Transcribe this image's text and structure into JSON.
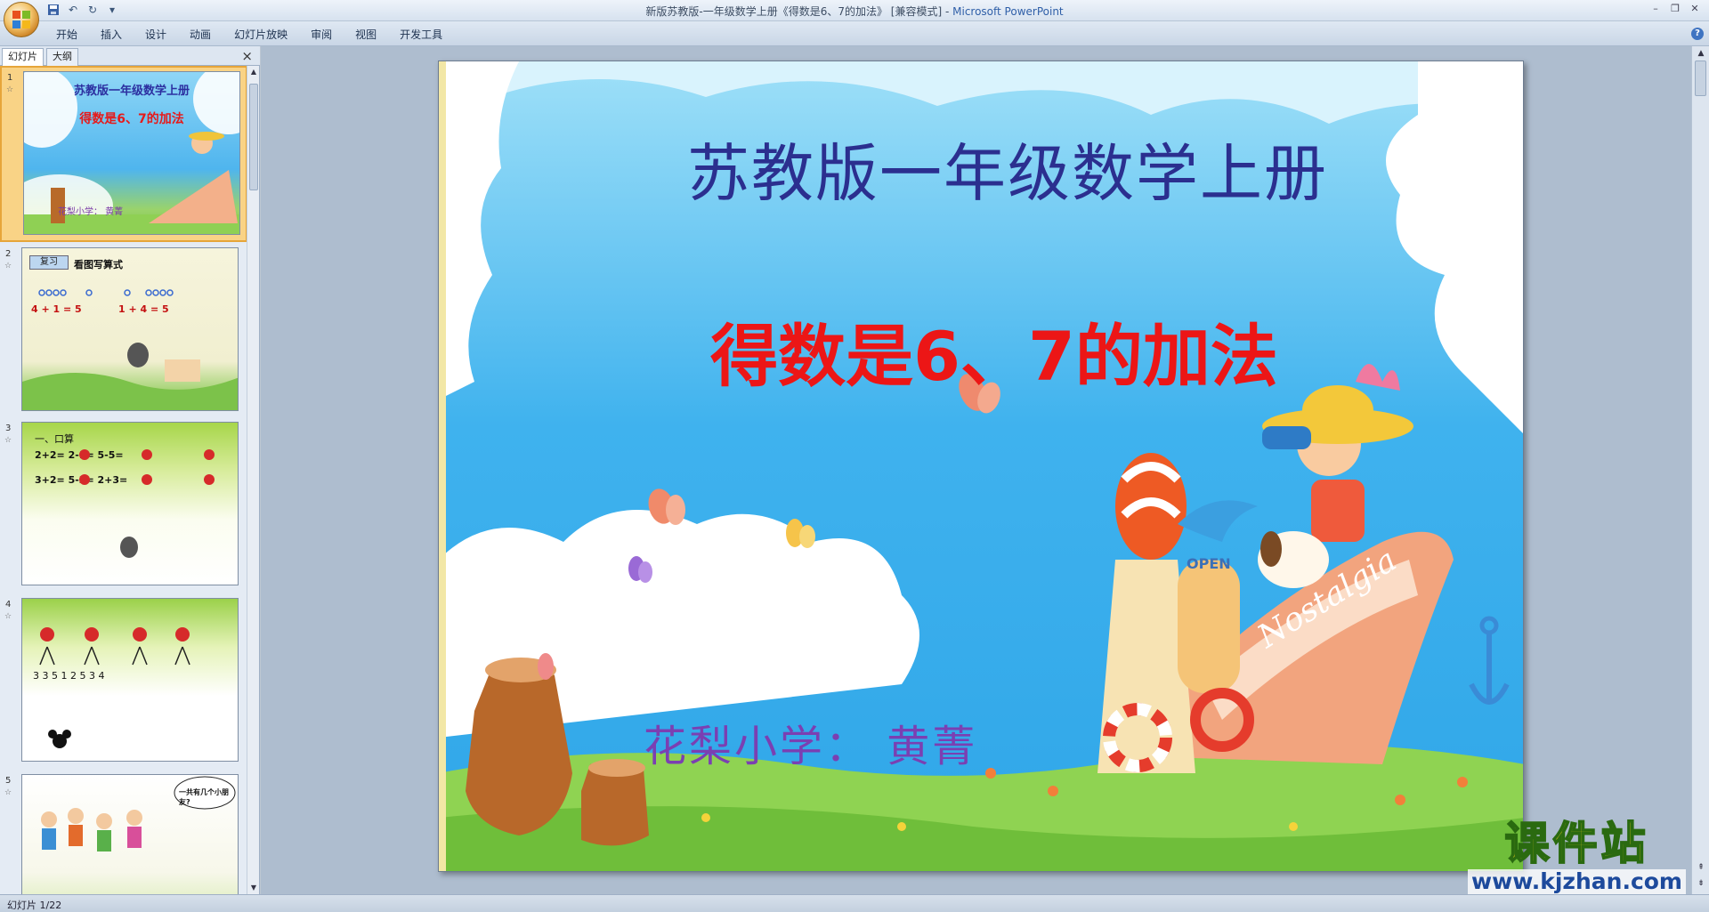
{
  "window": {
    "title": "新版苏教版-一年级数学上册《得数是6、7的加法》 [兼容模式] - ",
    "app_name": "Microsoft PowerPoint"
  },
  "ribbon": {
    "tabs": [
      "开始",
      "插入",
      "设计",
      "动画",
      "幻灯片放映",
      "审阅",
      "视图",
      "开发工具"
    ]
  },
  "left_panel": {
    "tabs": [
      "幻灯片",
      "大纲"
    ],
    "close_icon": "×",
    "thumbnails": [
      {
        "num": "1",
        "title": "苏教版一年级数学上册",
        "subtitle": "得数是6、7的加法",
        "author": "花梨小学：  黄菁"
      },
      {
        "num": "2",
        "header": "看图写算式",
        "badge": "复习",
        "eq1": "4 + 1 = 5",
        "eq2": "1 + 4 = 5"
      },
      {
        "num": "3",
        "header": "一、口算",
        "row1": "2+2=    2-1=    5-5=",
        "row2": "3+2=    5-3=    2+3="
      },
      {
        "num": "4",
        "row": "3  3   5  1   2  5   3  4"
      },
      {
        "num": "5",
        "bubble": "一共有几个小朋友?"
      }
    ]
  },
  "slide": {
    "title": "苏教版一年级数学上册",
    "subtitle": "得数是6、7的加法",
    "author": "花梨小学：  黄菁",
    "decoration_text": "Nostalgia",
    "open_sign": "OPEN"
  },
  "status": {
    "slide_indicator": "幻灯片 1/22"
  },
  "watermark": {
    "name": "课件站",
    "url": "www.kjzhan.com"
  },
  "colors": {
    "title_blue": "#2b2f8f",
    "subtitle_red": "#ec1616",
    "author_purple": "#7b3fb2",
    "sky": "#58b9f0"
  }
}
